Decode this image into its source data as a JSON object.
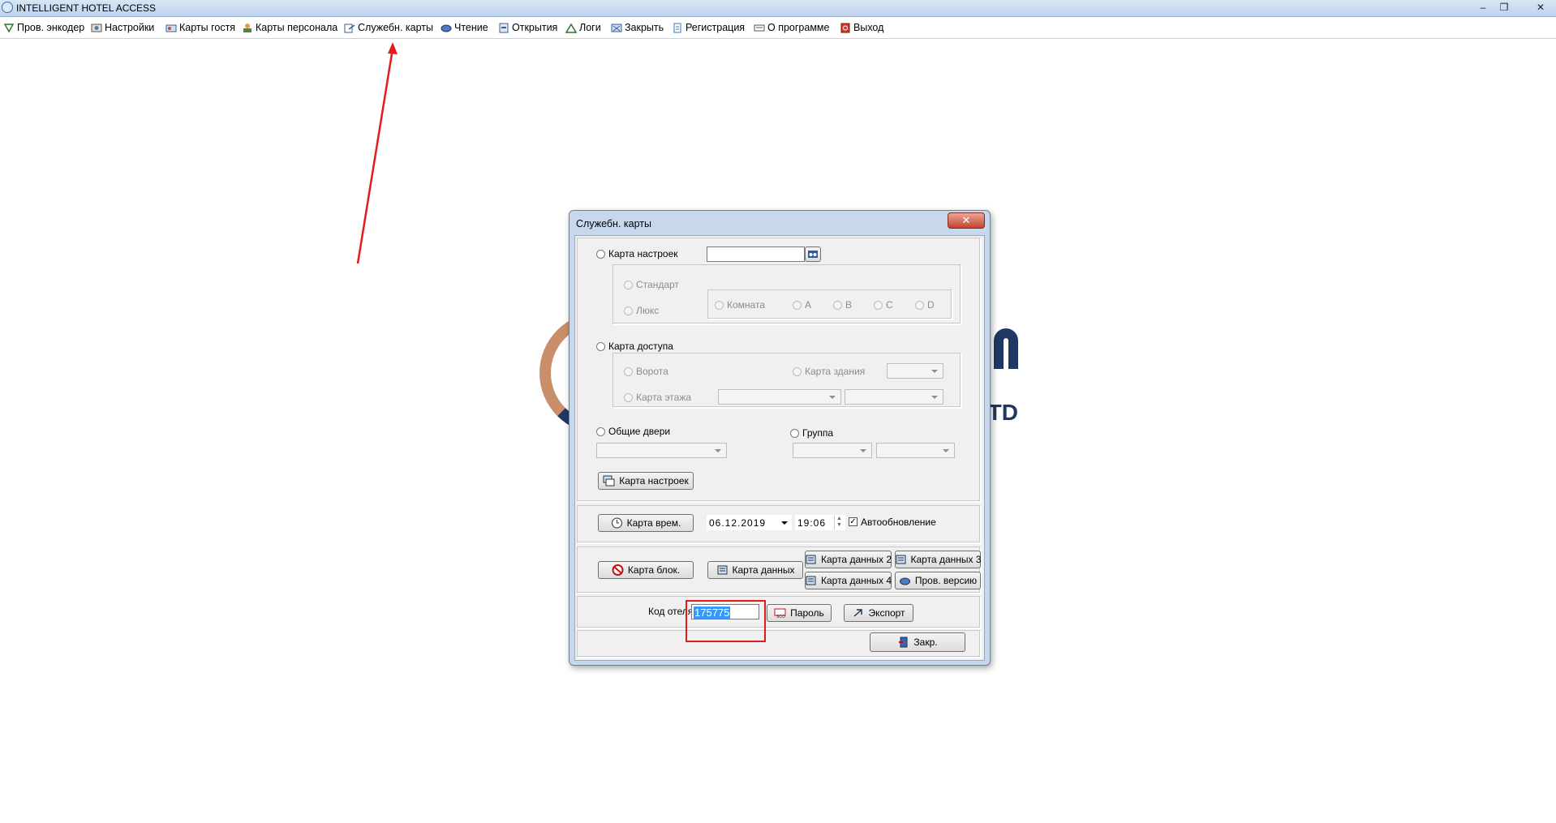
{
  "window": {
    "title": "INTELLIGENT HOTEL ACCESS",
    "minimize": "–",
    "restore": "❐",
    "close": "✕"
  },
  "menu": [
    {
      "label": "Пров. энкодер",
      "icon": "encoder-check-icon"
    },
    {
      "label": "Настройки",
      "icon": "settings-icon"
    },
    {
      "label": "Карты гостя",
      "icon": "guest-card-icon"
    },
    {
      "label": "Карты персонала",
      "icon": "staff-card-icon"
    },
    {
      "label": "Служебн. карты",
      "icon": "service-card-icon"
    },
    {
      "label": "Чтение",
      "icon": "read-icon"
    },
    {
      "label": "Открытия",
      "icon": "openings-icon"
    },
    {
      "label": "Логи",
      "icon": "logs-icon"
    },
    {
      "label": "Закрыть",
      "icon": "close-card-icon"
    },
    {
      "label": "Регистрация",
      "icon": "registration-icon"
    },
    {
      "label": "О программе",
      "icon": "about-icon"
    },
    {
      "label": "Выход",
      "icon": "exit-icon"
    }
  ],
  "logo": {
    "text": "TD"
  },
  "dialog": {
    "title": "Служебн. карты",
    "close": "✕",
    "settings_card": {
      "label": "Карта настроек",
      "value": "",
      "standard": "Стандарт",
      "lux": "Люкс",
      "room": "Комната",
      "a": "A",
      "b": "B",
      "c": "C",
      "d": "D"
    },
    "access_card": {
      "label": "Карта доступа",
      "gate": "Ворота",
      "building": "Карта здания",
      "floor": "Карта этажа"
    },
    "common_doors": {
      "label": "Общие двери",
      "group": "Группа"
    },
    "settings_card_button": "Карта настроек",
    "time_card_button": "Карта врем.",
    "date": "06.12.2019",
    "time": "19:06",
    "auto_update": "Автообновление",
    "block_card_button": "Карта блок.",
    "data_card_button": "Карта данных",
    "data_card_2": "Карта данных 2",
    "data_card_3": "Карта данных 3",
    "data_card_4": "Карта данных 4",
    "check_version": "Пров. версию",
    "hotel_code_label": "Код отеля",
    "hotel_code": "175775",
    "password_button": "Пароль",
    "export_button": "Экспорт",
    "close_button": "Закр."
  },
  "colors": {
    "annotation": "#e31b1b",
    "selection": "#3399ff",
    "dialog_frame": "#c7d8ec"
  }
}
